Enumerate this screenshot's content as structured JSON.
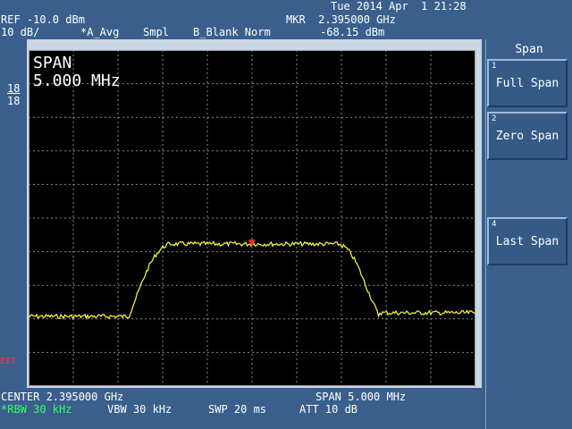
{
  "header": {
    "datetime": "Tue 2014 Apr  1 21:28",
    "ref_level": "REF -10.0 dBm",
    "scale": "10 dB/",
    "trace_mode": "*A_Avg",
    "detector": "Smpl",
    "trace_b": "B_Blank Norm",
    "marker_freq": "MKR  2.395000 GHz",
    "marker_level": "-68.15 dBm"
  },
  "left_markers": {
    "top": "18",
    "bottom": "18"
  },
  "ext_label": "EXT",
  "screen": {
    "span_title": "SPAN",
    "span_value": "5.000 MHz"
  },
  "footer": {
    "center": "CENTER 2.395000 GHz",
    "span": "SPAN 5.000 MHz",
    "rbw": "*RBW 30 kHz",
    "vbw": "VBW 30 kHz",
    "swp": "SWP 20 ms",
    "att": "ATT 10 dB"
  },
  "softkeys": {
    "title": "Span",
    "items": [
      {
        "num": "1",
        "label": "Full Span"
      },
      {
        "num": "2",
        "label": "Zero Span"
      },
      {
        "num": "4",
        "label": "Last Span"
      }
    ]
  },
  "colors": {
    "trace": "#ffff33",
    "marker": "#ff2a2a",
    "grid": "#8a8a8a",
    "rbw_text": "#33ff66",
    "ext_text": "#ff3333"
  }
}
